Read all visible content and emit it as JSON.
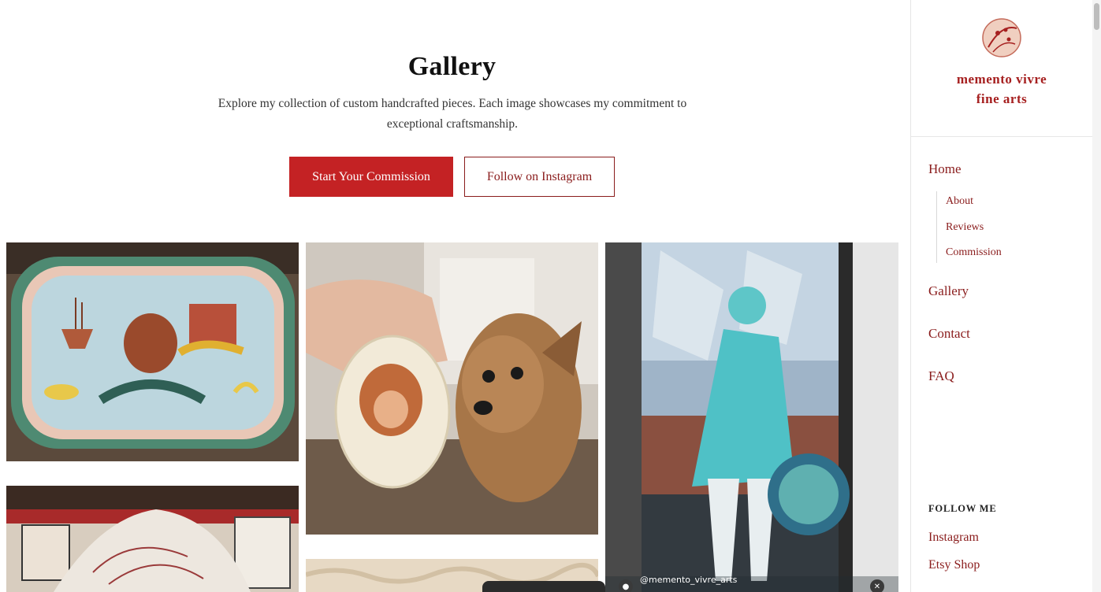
{
  "main": {
    "title": "Gallery",
    "description": "Explore my collection of custom handcrafted pieces. Each image showcases my commitment to exceptional craftsmanship.",
    "primary_button": "Start Your Commission",
    "secondary_button": "Follow on Instagram"
  },
  "gallery": {
    "items": [
      {
        "subject": "painted tray with ship, pomegranate and castle"
      },
      {
        "subject": "painted dog ornament held next to dog"
      },
      {
        "subject": "teal fairy mural on storefront window"
      },
      {
        "subject": "embroidered jacket on wall"
      },
      {
        "subject": "sheepskin rug"
      }
    ],
    "video_watermark": "@memento_vivre_arts"
  },
  "sidebar": {
    "logo_line1": "memento vivre",
    "logo_line2": "fine arts",
    "nav": {
      "home": "Home",
      "about": "About",
      "reviews": "Reviews",
      "commission": "Commission",
      "gallery": "Gallery",
      "contact": "Contact",
      "faq": "FAQ"
    },
    "follow_heading": "FOLLOW ME",
    "instagram": "Instagram",
    "etsy": "Etsy Shop"
  },
  "colors": {
    "accent": "#c42224",
    "link": "#8a1c1c",
    "logo": "#a62020"
  }
}
